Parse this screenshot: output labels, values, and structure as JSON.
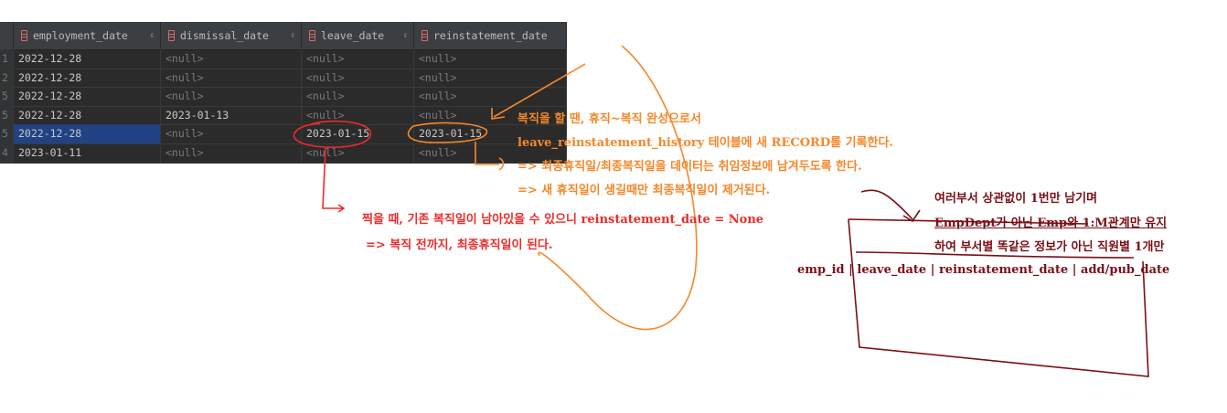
{
  "grid": {
    "columns": [
      {
        "label": "employment_date",
        "icon": "column-key-icon"
      },
      {
        "label": "dismissal_date",
        "icon": "column-icon"
      },
      {
        "label": "leave_date",
        "icon": "column-icon"
      },
      {
        "label": "reinstatement_date",
        "icon": "column-icon"
      }
    ],
    "rows": [
      {
        "num": "1",
        "cells": [
          "2022-12-28",
          "<null>",
          "<null>",
          "<null>"
        ]
      },
      {
        "num": "2",
        "cells": [
          "2022-12-28",
          "<null>",
          "<null>",
          "<null>"
        ]
      },
      {
        "num": "5",
        "cells": [
          "2022-12-28",
          "<null>",
          "<null>",
          "<null>"
        ]
      },
      {
        "num": "5",
        "cells": [
          "2022-12-28",
          "2023-01-13",
          "<null>",
          "<null>"
        ]
      },
      {
        "num": "5",
        "cells": [
          "2022-12-28",
          "<null>",
          "2023-01-15",
          "2023-01-15"
        ],
        "selected": true
      },
      {
        "num": "4",
        "cells": [
          "2023-01-11",
          "<null>",
          "<null>",
          "<null>"
        ]
      }
    ]
  },
  "notes": {
    "orange": [
      "복직을 할 땐, 휴직~복직 완성으로서",
      "leave_reinstatement_history 테이블에 새 RECORD를 기록한다.",
      " => 최종휴직일/최종복직일을 데이터는 취임정보에 남겨두도록 한다.",
      "=>  새 휴직일이 생길때만 최종복직일이 제거된다."
    ],
    "red": [
      "찍을 때, 기존 복직일이 남아있을 수 있으니 reinstatement_date = None",
      " => 복직 전까지, 최종휴직일이 된다."
    ],
    "maroon": [
      "여러부서 상관없이 1번만 남기며",
      "EmpDept가 아닌 Emp와 1:M관계만 유지",
      "하여 부서별 똑같은 정보가 아닌 직원별 1개만",
      "emp_id |  leave_date | reinstatement_date | add/pub_date"
    ]
  },
  "colors": {
    "orange": "#f5872a",
    "red": "#ee2a2a",
    "maroon": "#7b0f17",
    "selection": "#214283"
  }
}
